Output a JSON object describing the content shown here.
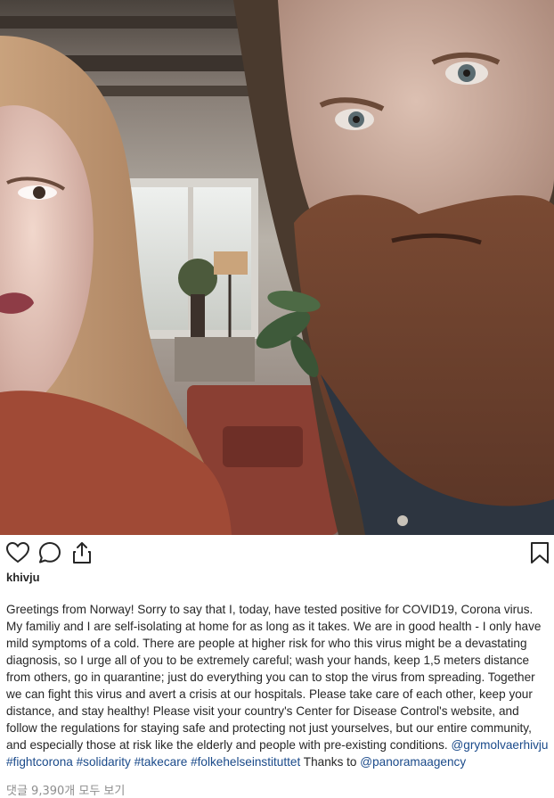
{
  "post": {
    "photo_alt": "selfie photo",
    "username": "khivju",
    "caption_text": "Greetings from Norway! Sorry to say that I, today, have tested positive for COVID19, Corona virus. My familiy and I are self-isolating at home for as long as it takes. We are in good health - I only have mild symptoms of a cold. There are people at higher risk for who this virus might be a devastating diagnosis, so I urge all of you to be extremely careful; wash your hands, keep 1,5 meters distance from others, go in quarantine; just do everything you can to stop the virus from spreading. Together we can fight this virus and avert a crisis at our hospitals. Please take care of each other, keep your distance, and stay healthy! Please visit your country's Center for Disease Control's website, and follow the regulations for staying safe and protecting not just yourselves, but our entire community, and especially those at risk like the elderly and people with pre-existing conditions.",
    "mentions_tags": [
      "@grymolvaerhivju",
      "#fightcorona",
      "#solidarity",
      "#takecare",
      "#folkehelseinstituttet"
    ],
    "thanks_text": "Thanks to",
    "thanks_mention": "@panoramaagency",
    "comments_link": "댓글 9,390개 모두 보기"
  },
  "icons": {
    "like": "heart-icon",
    "comment": "comment-icon",
    "share": "share-icon",
    "save": "bookmark-icon"
  },
  "colors": {
    "text": "#262626",
    "link": "#1a4a8a",
    "muted": "#8e8e8e",
    "background": "#ffffff"
  }
}
